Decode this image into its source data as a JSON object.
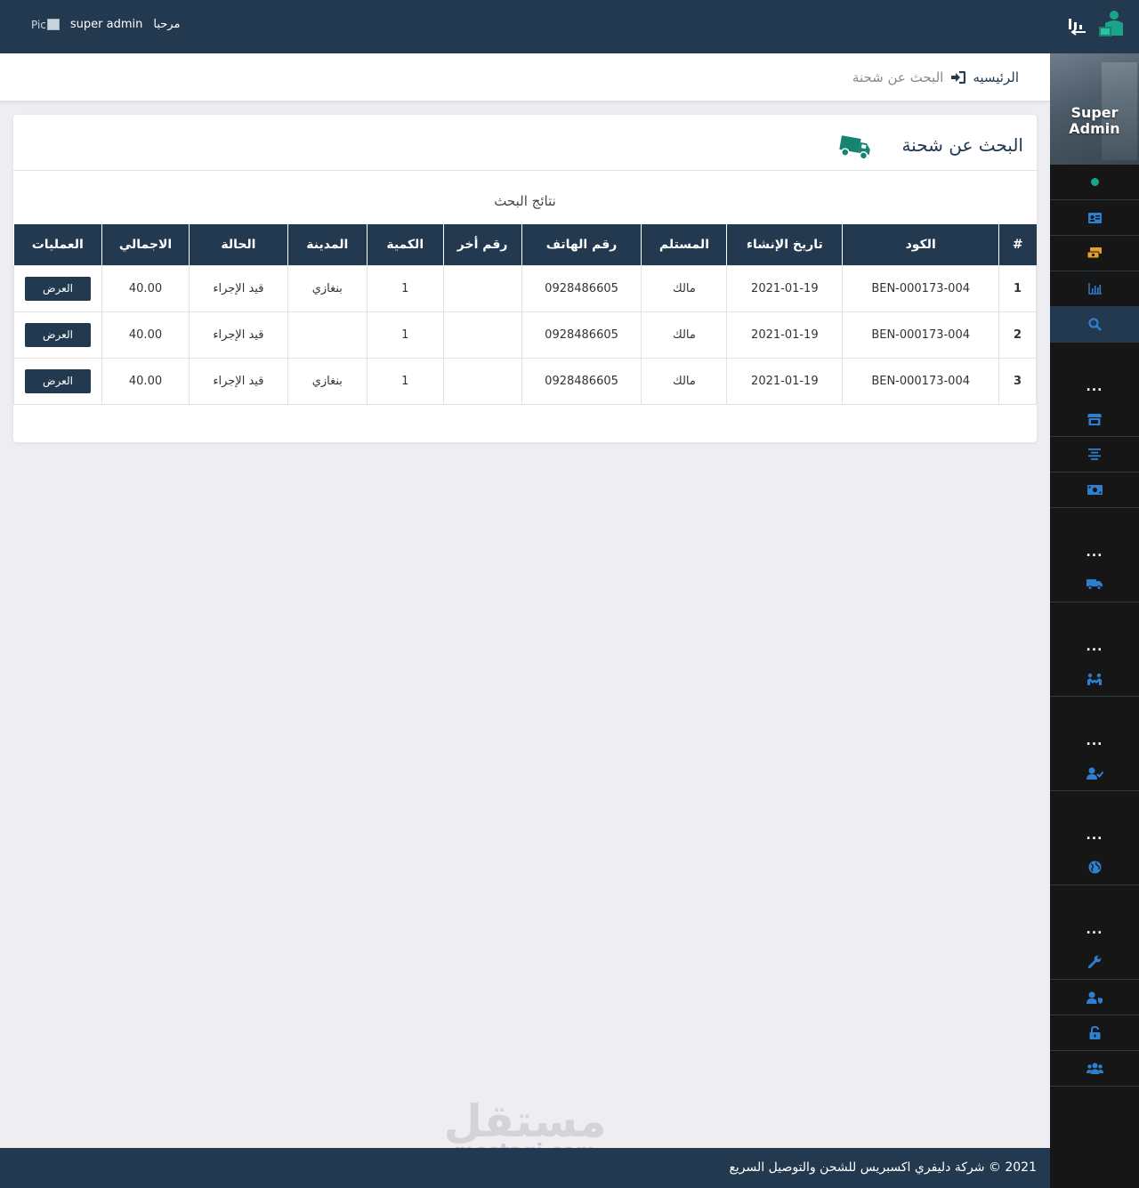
{
  "header": {
    "greeting": "مرحبا",
    "username": "super admin",
    "avatar_alt": "Pic"
  },
  "sidebar": {
    "profile_name_line1": "Super",
    "profile_name_line2": "Admin",
    "sections": [
      {
        "items": [
          "status-dot",
          "id-card-icon",
          "money-stack-icon",
          "bar-chart-icon",
          "search-icon"
        ]
      },
      {
        "separator": "...",
        "items": [
          "store-icon",
          "align-center-icon",
          "cash-icon"
        ]
      },
      {
        "separator": "...",
        "items": [
          "truck-icon"
        ]
      },
      {
        "separator": "...",
        "items": [
          "handshake-icon"
        ]
      },
      {
        "separator": "...",
        "items": [
          "user-check-icon"
        ]
      },
      {
        "separator": "...",
        "items": [
          "globe-icon"
        ]
      },
      {
        "separator": "...",
        "items": [
          "wrench-icon",
          "user-shield-icon",
          "unlock-icon",
          "users-icon"
        ]
      }
    ],
    "icon_color": "#2f7fd1",
    "accent_color": "#1aa58a",
    "active_item": "search-icon"
  },
  "breadcrumb": {
    "home": "الرئيسيه",
    "current": "البحث عن شحنة"
  },
  "card": {
    "title": "البحث عن شحنة",
    "title_icon": "truck-icon",
    "results_label": "نتائج البحث"
  },
  "table": {
    "columns": [
      "#",
      "الكود",
      "تاريخ الإنشاء",
      "المستلم",
      "رقم الهاتف",
      "رقم أخر",
      "الكمية",
      "المدينة",
      "الحالة",
      "الاجمالي",
      "العمليات"
    ],
    "rows": [
      {
        "index": "1",
        "code": "BEN-000173-004",
        "created": "2021-01-19",
        "receiver": "مالك",
        "phone": "0928486605",
        "alt_phone": "",
        "qty": "1",
        "city": "بنغازي",
        "status": "قيد الإجراء",
        "total": "40.00",
        "action": "العرض"
      },
      {
        "index": "2",
        "code": "BEN-000173-004",
        "created": "2021-01-19",
        "receiver": "مالك",
        "phone": "0928486605",
        "alt_phone": "",
        "qty": "1",
        "city": "",
        "status": "قيد الإجراء",
        "total": "40.00",
        "action": "العرض"
      },
      {
        "index": "3",
        "code": "BEN-000173-004",
        "created": "2021-01-19",
        "receiver": "مالك",
        "phone": "0928486605",
        "alt_phone": "",
        "qty": "1",
        "city": "بنغازي",
        "status": "قيد الإجراء",
        "total": "40.00",
        "action": "العرض"
      }
    ]
  },
  "footer": {
    "year": "2021",
    "copyright_symbol": "©",
    "company": "شركة دليفري اكسبريس للشحن والتوصيل السريع"
  },
  "watermark": {
    "arabic": "مستقل",
    "latin": "mostaqi.com"
  },
  "colors": {
    "primary": "#22394f",
    "sidebar_bg": "#161616",
    "page_bg": "#ededf2",
    "accent": "#1aa58a"
  }
}
